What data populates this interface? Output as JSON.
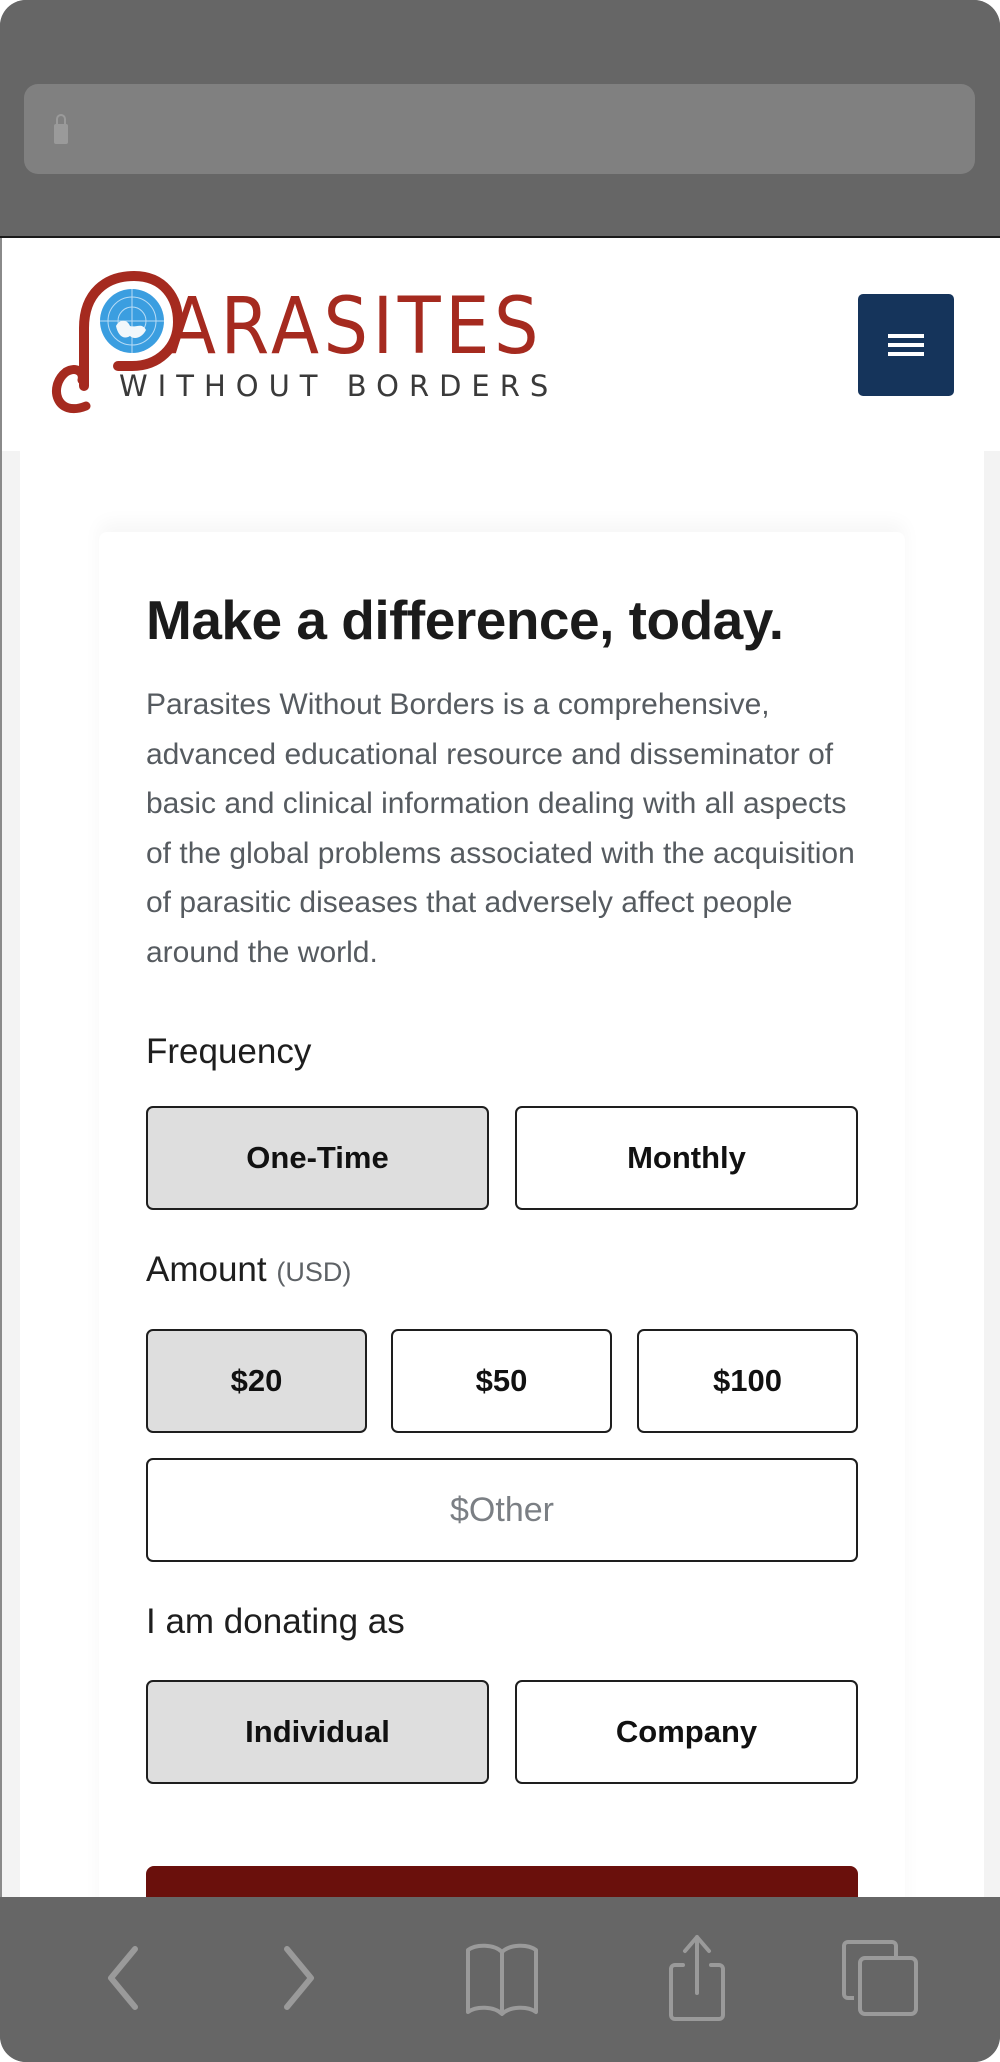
{
  "browser": {
    "url_bar": {
      "icon": "lock-icon",
      "url": ""
    },
    "toolbar": [
      {
        "name": "back",
        "icon": "chevron-left-icon"
      },
      {
        "name": "forward",
        "icon": "chevron-right-icon"
      },
      {
        "name": "bookmarks",
        "icon": "book-icon"
      },
      {
        "name": "share",
        "icon": "share-icon"
      },
      {
        "name": "tabs",
        "icon": "tabs-icon"
      }
    ]
  },
  "header": {
    "logo": {
      "title": "PARASITES",
      "title_tail": "ARASITES",
      "subtitle": "WITHOUT BORDERS"
    },
    "menu_icon": "hamburger-icon"
  },
  "colors": {
    "brand_red": "#a52a1f",
    "globe_blue": "#3b9ee0",
    "menu_navy": "#15345b",
    "donate_red": "#6a100c",
    "selected_bg": "#dedede"
  },
  "form": {
    "heading": "Make a difference, today.",
    "description": "Parasites Without Borders is a comprehensive, advanced educational resource and disseminator of basic and clinical information dealing with all aspects of the global problems associated with the acquisition of parasitic diseases that adversely affect people around the world.",
    "frequency": {
      "label": "Frequency",
      "options": [
        {
          "label": "One-Time",
          "selected": true
        },
        {
          "label": "Monthly",
          "selected": false
        }
      ]
    },
    "amount": {
      "label": "Amount",
      "currency": "(USD)",
      "options": [
        {
          "label": "$20",
          "selected": true
        },
        {
          "label": "$50",
          "selected": false
        },
        {
          "label": "$100",
          "selected": false
        }
      ],
      "other_placeholder": "$Other",
      "other_value": ""
    },
    "donor_type": {
      "label": "I am donating as",
      "options": [
        {
          "label": "Individual",
          "selected": true
        },
        {
          "label": "Company",
          "selected": false
        }
      ]
    },
    "submit_label": ""
  }
}
